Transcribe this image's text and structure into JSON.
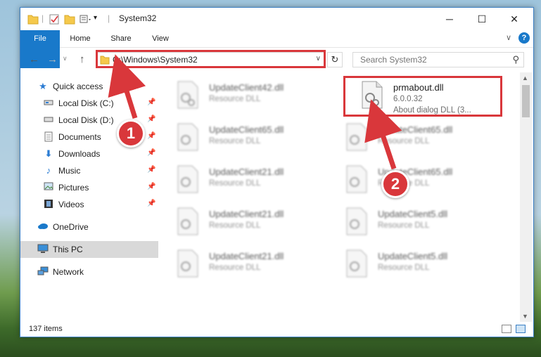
{
  "window": {
    "title": "System32",
    "controls": {
      "minimize": "─",
      "maximize": "☐",
      "close": "✕"
    }
  },
  "ribbon": {
    "tabs": [
      "File",
      "Home",
      "Share",
      "View"
    ],
    "expand_icon": "chevron-down-icon",
    "help_label": "?"
  },
  "navigation": {
    "path": "C:\\Windows\\System32",
    "search_placeholder": "Search System32"
  },
  "sidebar": {
    "quick_access": "Quick access",
    "items": [
      {
        "label": "Local Disk (C:)",
        "pinned": true
      },
      {
        "label": "Local Disk (D:)",
        "pinned": true
      },
      {
        "label": "Documents",
        "pinned": true
      },
      {
        "label": "Downloads",
        "pinned": true
      },
      {
        "label": "Music",
        "pinned": true
      },
      {
        "label": "Pictures",
        "pinned": true
      },
      {
        "label": "Videos",
        "pinned": true
      }
    ],
    "onedrive": "OneDrive",
    "this_pc": "This PC",
    "network": "Network"
  },
  "files": {
    "highlighted": {
      "name": "prmabout.dll",
      "version": "6.0.0.32",
      "description": "About dialog DLL (3..."
    },
    "blurred": [
      {
        "name": "UpdateClient42.dll",
        "type": "Resource DLL"
      },
      {
        "name": "UpdateClient65.dll",
        "type": "Resource DLL"
      },
      {
        "name": "UpdateClient65.dll",
        "type": "Resource DLL"
      },
      {
        "name": "UpdateClient21.dll",
        "type": "Resource DLL"
      },
      {
        "name": "UpdateClient65.dll",
        "type": "Resource DLL"
      },
      {
        "name": "UpdateClient21.dll",
        "type": "Resource DLL"
      },
      {
        "name": "UpdateClient5.dll",
        "type": "Resource DLL"
      },
      {
        "name": "UpdateClient21.dll",
        "type": "Resource DLL"
      },
      {
        "name": "UpdateClient5.dll",
        "type": "Resource DLL"
      }
    ]
  },
  "status": {
    "item_count": "137 items"
  },
  "annotations": {
    "step1": "1",
    "step2": "2",
    "color": "#d9373b"
  }
}
